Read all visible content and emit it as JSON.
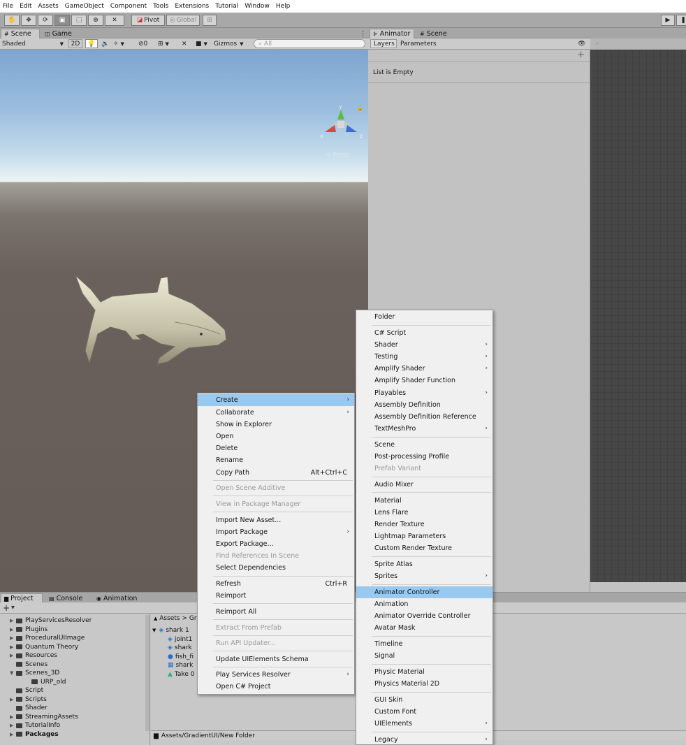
{
  "menubar": [
    "File",
    "Edit",
    "Assets",
    "GameObject",
    "Component",
    "Tools",
    "Extensions",
    "Tutorial",
    "Window",
    "Help"
  ],
  "toolbar": {
    "pivot": "Pivot",
    "global": "Global",
    "tools": [
      "hand-tool",
      "move-tool",
      "rotate-tool",
      "scale-tool",
      "rect-tool",
      "transform-tool",
      "custom-tool"
    ]
  },
  "scene": {
    "tabs": [
      "Scene",
      "Game"
    ],
    "shading": "Shaded",
    "mode_2d": "2D",
    "hidden_count": "0",
    "gizmos": "Gizmos",
    "search_placeholder": "All",
    "projection": "< Persp",
    "axis_labels": {
      "y": "y",
      "x": "x",
      "z": "z"
    }
  },
  "animator": {
    "tabs": [
      "Animator",
      "Scene"
    ],
    "subtabs": [
      "Layers",
      "Parameters"
    ],
    "empty_text": "List is Empty"
  },
  "project": {
    "tabs": [
      "Project",
      "Console",
      "Animation"
    ],
    "add": "+",
    "tree": [
      {
        "label": "PlayServicesResolver",
        "indent": 1,
        "arrow": true
      },
      {
        "label": "Plugins",
        "indent": 1,
        "arrow": true
      },
      {
        "label": "ProceduralUIImage",
        "indent": 1,
        "arrow": true
      },
      {
        "label": "Quantum Theory",
        "indent": 1,
        "arrow": true
      },
      {
        "label": "Resources",
        "indent": 1,
        "arrow": true
      },
      {
        "label": "Scenes",
        "indent": 1,
        "arrow": false
      },
      {
        "label": "Scenes_3D",
        "indent": 1,
        "arrow": true,
        "open": true
      },
      {
        "label": "URP_old",
        "indent": 2,
        "arrow": false
      },
      {
        "label": "Script",
        "indent": 1,
        "arrow": false
      },
      {
        "label": "Scripts",
        "indent": 1,
        "arrow": true
      },
      {
        "label": "Shader",
        "indent": 1,
        "arrow": false
      },
      {
        "label": "StreamingAssets",
        "indent": 1,
        "arrow": true
      },
      {
        "label": "TutorialInfo",
        "indent": 1,
        "arrow": true
      },
      {
        "label": "Packages",
        "indent": 0,
        "arrow": true,
        "bold": true
      }
    ],
    "breadcrumb": [
      "Assets",
      ">",
      "Grad"
    ],
    "files": [
      {
        "label": "shark 1",
        "indent": 0
      },
      {
        "label": "joint1",
        "indent": 1
      },
      {
        "label": "shark",
        "indent": 1
      },
      {
        "label": "fish_fi",
        "indent": 1
      },
      {
        "label": "shark",
        "indent": 1
      },
      {
        "label": "Take 0",
        "indent": 1
      }
    ],
    "status_path": "Assets/GradientUI/New Folder"
  },
  "context_menu": [
    {
      "label": "Create",
      "submenu": true,
      "highlight": true
    },
    {
      "label": "Collaborate",
      "submenu": true
    },
    {
      "label": "Show in Explorer"
    },
    {
      "label": "Open"
    },
    {
      "label": "Delete"
    },
    {
      "label": "Rename"
    },
    {
      "label": "Copy Path",
      "shortcut": "Alt+Ctrl+C"
    },
    {
      "sep": true
    },
    {
      "label": "Open Scene Additive",
      "disabled": true
    },
    {
      "sep": true
    },
    {
      "label": "View in Package Manager",
      "disabled": true
    },
    {
      "sep": true
    },
    {
      "label": "Import New Asset..."
    },
    {
      "label": "Import Package",
      "submenu": true
    },
    {
      "label": "Export Package..."
    },
    {
      "label": "Find References In Scene",
      "disabled": true
    },
    {
      "label": "Select Dependencies"
    },
    {
      "sep": true
    },
    {
      "label": "Refresh",
      "shortcut": "Ctrl+R"
    },
    {
      "label": "Reimport"
    },
    {
      "sep": true
    },
    {
      "label": "Reimport All"
    },
    {
      "sep": true
    },
    {
      "label": "Extract From Prefab",
      "disabled": true
    },
    {
      "sep": true
    },
    {
      "label": "Run API Updater...",
      "disabled": true
    },
    {
      "sep": true
    },
    {
      "label": "Update UIElements Schema"
    },
    {
      "sep": true
    },
    {
      "label": "Play Services Resolver",
      "submenu": true
    },
    {
      "label": "Open C# Project"
    }
  ],
  "create_menu": [
    {
      "label": "Folder"
    },
    {
      "sep": true
    },
    {
      "label": "C# Script"
    },
    {
      "label": "Shader",
      "submenu": true
    },
    {
      "label": "Testing",
      "submenu": true
    },
    {
      "label": "Amplify Shader",
      "submenu": true
    },
    {
      "label": "Amplify Shader Function"
    },
    {
      "label": "Playables",
      "submenu": true
    },
    {
      "label": "Assembly Definition"
    },
    {
      "label": "Assembly Definition Reference"
    },
    {
      "label": "TextMeshPro",
      "submenu": true
    },
    {
      "sep": true
    },
    {
      "label": "Scene"
    },
    {
      "label": "Post-processing Profile"
    },
    {
      "label": "Prefab Variant",
      "disabled": true
    },
    {
      "sep": true
    },
    {
      "label": "Audio Mixer"
    },
    {
      "sep": true
    },
    {
      "label": "Material"
    },
    {
      "label": "Lens Flare"
    },
    {
      "label": "Render Texture"
    },
    {
      "label": "Lightmap Parameters"
    },
    {
      "label": "Custom Render Texture"
    },
    {
      "sep": true
    },
    {
      "label": "Sprite Atlas"
    },
    {
      "label": "Sprites",
      "submenu": true
    },
    {
      "sep": true
    },
    {
      "label": "Animator Controller",
      "highlight": true
    },
    {
      "label": "Animation"
    },
    {
      "label": "Animator Override Controller"
    },
    {
      "label": "Avatar Mask"
    },
    {
      "sep": true
    },
    {
      "label": "Timeline"
    },
    {
      "label": "Signal"
    },
    {
      "sep": true
    },
    {
      "label": "Physic Material"
    },
    {
      "label": "Physics Material 2D"
    },
    {
      "sep": true
    },
    {
      "label": "GUI Skin"
    },
    {
      "label": "Custom Font"
    },
    {
      "label": "UIElements",
      "submenu": true
    },
    {
      "sep": true
    },
    {
      "label": "Legacy",
      "submenu": true
    }
  ]
}
